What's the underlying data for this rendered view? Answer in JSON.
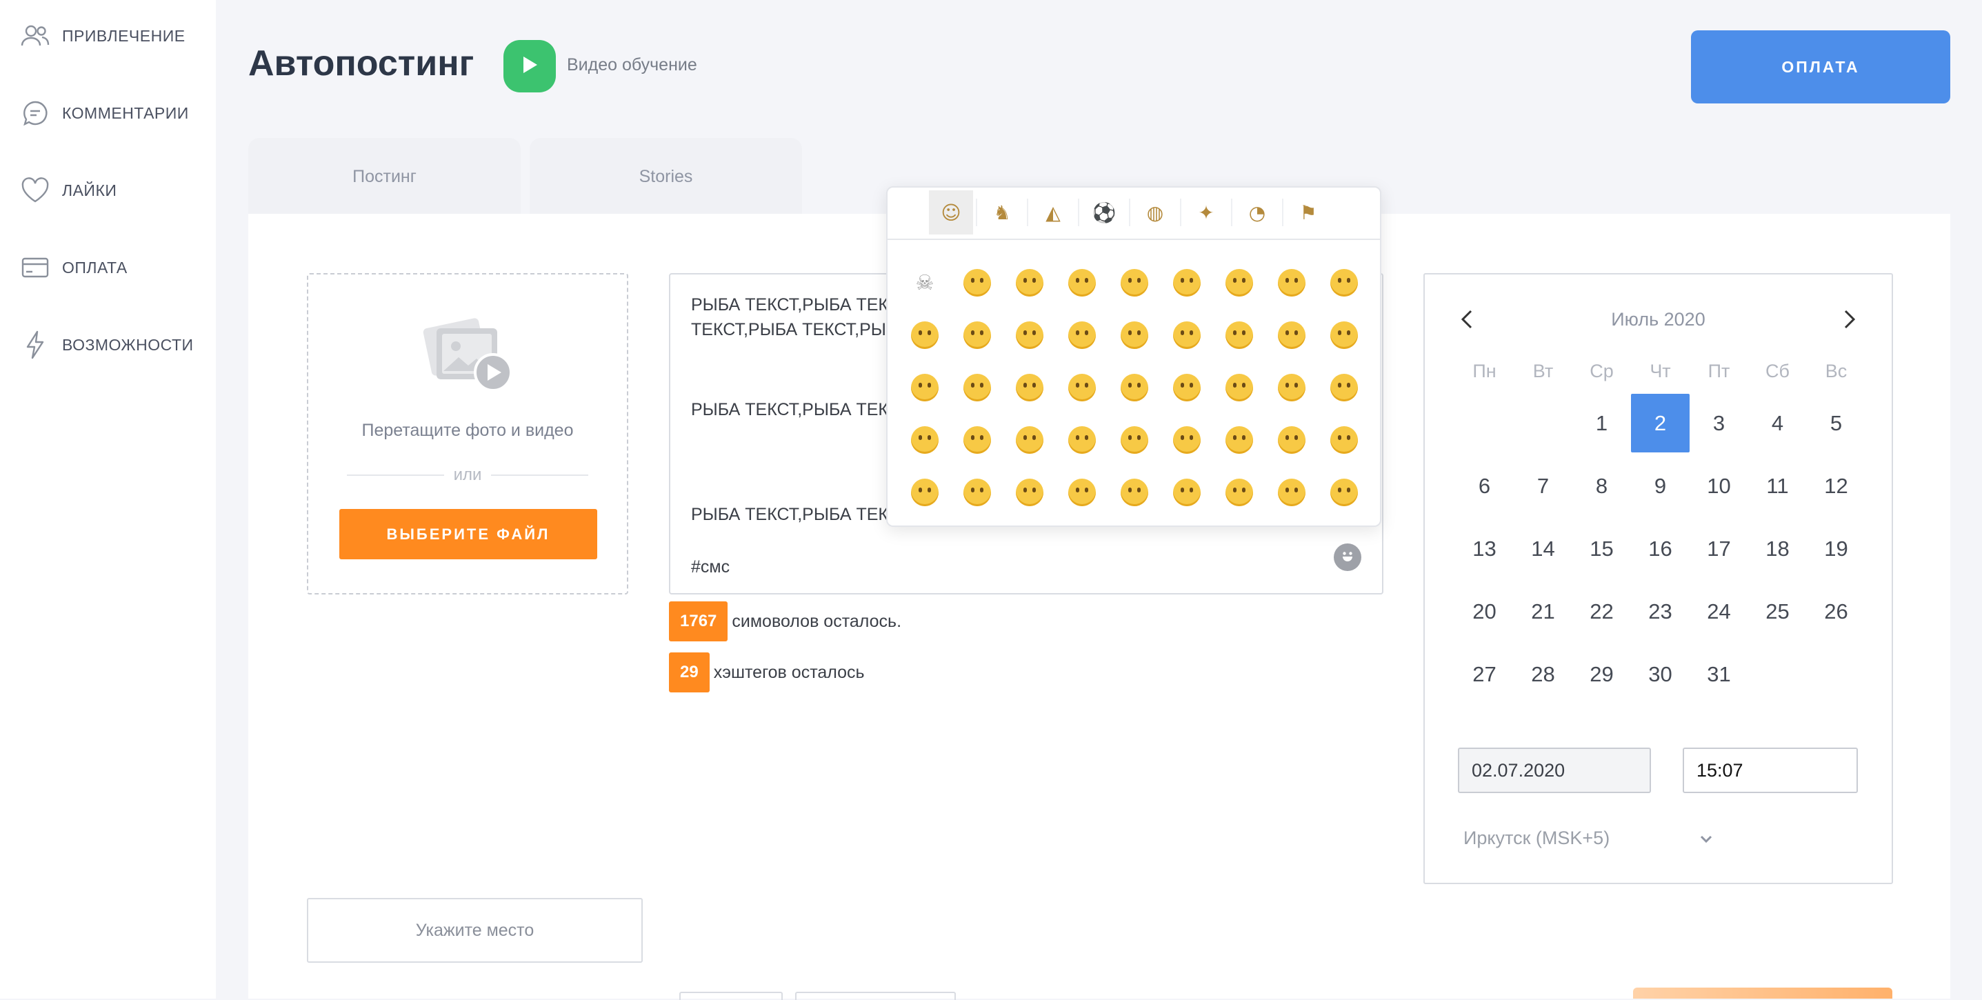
{
  "sidebar": {
    "items": [
      {
        "label": "ПРИВЛЕЧЕНИЕ",
        "icon": "users-icon"
      },
      {
        "label": "КОММЕНТАРИИ",
        "icon": "comment-icon"
      },
      {
        "label": "ЛАЙКИ",
        "icon": "heart-icon"
      },
      {
        "label": "ОПЛАТА",
        "icon": "credit-card-icon"
      },
      {
        "label": "ВОЗМОЖНОСТИ",
        "icon": "lightning-icon"
      }
    ]
  },
  "header": {
    "title": "Автопостинг",
    "video_label": "Видео обучение",
    "pay_button": "ОПЛАТА"
  },
  "tabs": [
    {
      "label": "Постинг"
    },
    {
      "label": "Stories"
    }
  ],
  "upload": {
    "hint": "Перетащите фото и видео",
    "or": "или",
    "choose_button": "ВЫБЕРИТЕ ФАЙЛ"
  },
  "post": {
    "lines": [
      "РЫБА ТЕКСТ,РЫБА ТЕКС",
      "ТЕКСТ,РЫБА ТЕКСТ,РЫ",
      "РЫБА ТЕКСТ,РЫБА ТЕКС",
      "РЫБА ТЕКСТ,РЫБА ТЕКС",
      "#смс"
    ]
  },
  "counters": {
    "chars_left": "1767",
    "chars_text": "симоволов осталось.",
    "hashtags_left": "29",
    "hashtags_text": "хэштегов осталось"
  },
  "location": {
    "placeholder": "Укажите место"
  },
  "calendar": {
    "month": "Июль 2020",
    "weekdays": [
      "Пн",
      "Вт",
      "Ср",
      "Чт",
      "Пт",
      "Сб",
      "Вс"
    ],
    "weeks": [
      [
        "",
        "",
        "1",
        "2",
        "3",
        "4",
        "5"
      ],
      [
        "6",
        "7",
        "8",
        "9",
        "10",
        "11",
        "12"
      ],
      [
        "13",
        "14",
        "15",
        "16",
        "17",
        "18",
        "19"
      ],
      [
        "20",
        "21",
        "22",
        "23",
        "24",
        "25",
        "26"
      ],
      [
        "27",
        "28",
        "29",
        "30",
        "31",
        "",
        ""
      ]
    ],
    "selected_day": "2",
    "date_value": "02.07.2020",
    "time_value": "15:07",
    "timezone": "Иркутск (MSK+5)",
    "accent_color": "#4d8eea"
  },
  "emoji_picker": {
    "categories": [
      {
        "name": "smileys-icon",
        "glyph": "☺"
      },
      {
        "name": "animals-icon",
        "glyph": "♞"
      },
      {
        "name": "food-icon",
        "glyph": "◭"
      },
      {
        "name": "sports-icon",
        "glyph": "⚽"
      },
      {
        "name": "travel-icon",
        "glyph": "◍"
      },
      {
        "name": "objects-icon",
        "glyph": "✦"
      },
      {
        "name": "symbols-icon",
        "glyph": "◔"
      },
      {
        "name": "flags-icon",
        "glyph": "⚑"
      }
    ],
    "active_category": 0,
    "rows": 5,
    "cols": 9
  },
  "colors": {
    "orange": "#ff8a1f",
    "blue": "#4d8eea",
    "green": "#3cc36f"
  }
}
